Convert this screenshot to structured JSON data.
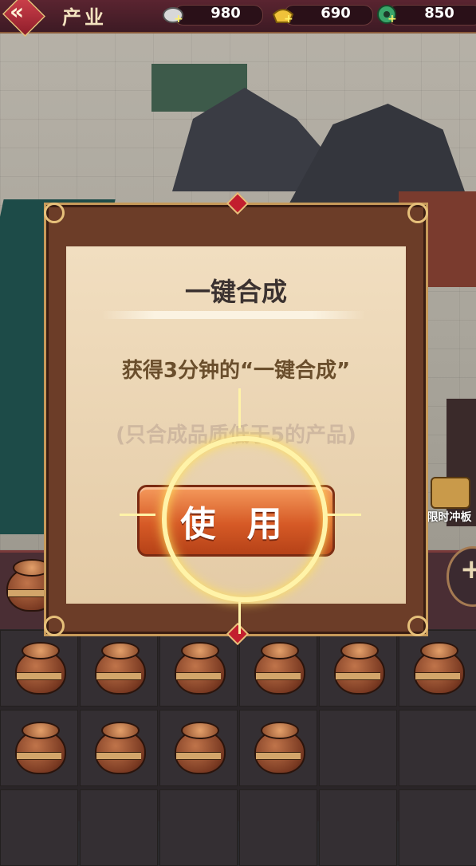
{
  "topbar": {
    "back_icon": "back-arrow-icon",
    "title": "产业",
    "resources": [
      {
        "icon": "silver-coin-icon",
        "value": "980"
      },
      {
        "icon": "gold-ingot-icon",
        "value": "690"
      },
      {
        "icon": "jade-icon",
        "value": "850"
      }
    ]
  },
  "side_item": {
    "label": "限时冲板"
  },
  "modal": {
    "title": "一键合成",
    "description": "获得3分钟的“一键合成”",
    "note": "(只合成品质低于5的产品)",
    "use_button": "使 用"
  },
  "inventory": {
    "row1": [
      "jar",
      "jar",
      "jar",
      "jar",
      "jar",
      "jar"
    ],
    "row2": [
      "jar",
      "jar",
      "jar",
      "jar",
      "empty",
      "empty"
    ]
  },
  "colors": {
    "button_orange": "#d65a26",
    "modal_frame": "#6c3d28",
    "paper": "#f1dec0"
  }
}
